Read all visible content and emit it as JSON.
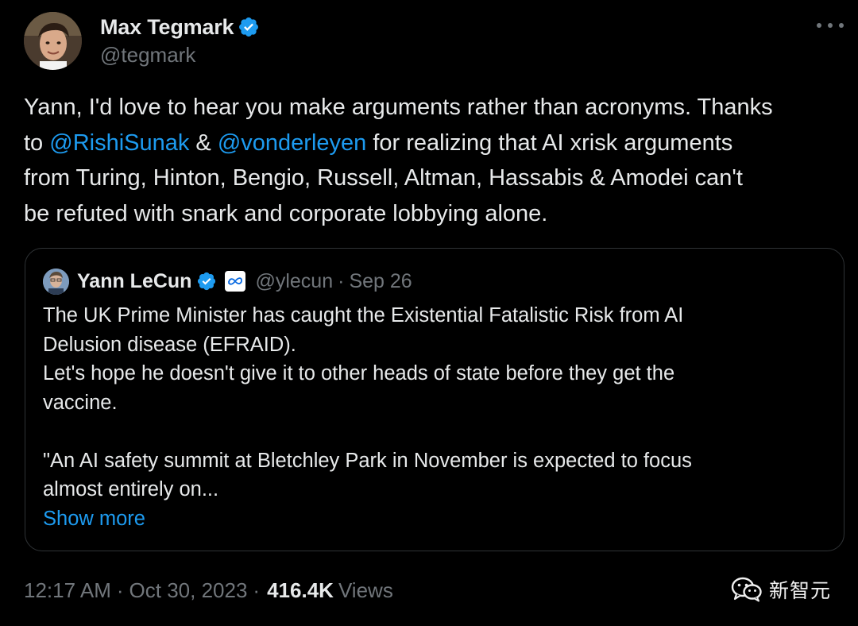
{
  "tweet": {
    "author": {
      "name": "Max Tegmark",
      "handle": "@tegmark"
    },
    "text_lines": [
      [
        "Yann, I'd love to hear you make arguments rather than acronyms. Thanks"
      ],
      [
        "to ",
        "@RishiSunak",
        " & ",
        "@vonderleyen",
        " for realizing that AI xrisk arguments"
      ],
      [
        "from Turing, Hinton, Bengio, Russell, Altman, Hassabis & Amodei can't"
      ],
      [
        "be refuted with snark and corporate lobbying alone."
      ]
    ],
    "footer": {
      "time": "12:17 AM",
      "separator": "·",
      "date": "Oct 30, 2023",
      "views_count": "416.4K",
      "views_label": "Views"
    }
  },
  "quote": {
    "author": {
      "name": "Yann LeCun",
      "handle": "@ylecun",
      "separator": "·",
      "date": "Sep 26"
    },
    "text_lines": [
      "The UK Prime Minister has caught the Existential Fatalistic Risk from AI",
      "Delusion disease (EFRAID).",
      "Let's hope he doesn't give it to other heads of state before they get the",
      "vaccine.",
      "",
      "\"An AI safety summit at Bletchley Park in November is expected to focus",
      "almost entirely on..."
    ],
    "show_more": "Show more"
  },
  "watermark": {
    "text": "新智元"
  },
  "colors": {
    "background": "#000000",
    "text": "#e7e9ea",
    "muted": "#71767b",
    "link": "#1d9bf0",
    "border": "#2f3336"
  },
  "icons": {
    "verified": "verified-badge-icon",
    "more": "more-horizontal-icon",
    "affiliate": "meta-logo-icon",
    "watermark": "wechat-icon"
  }
}
